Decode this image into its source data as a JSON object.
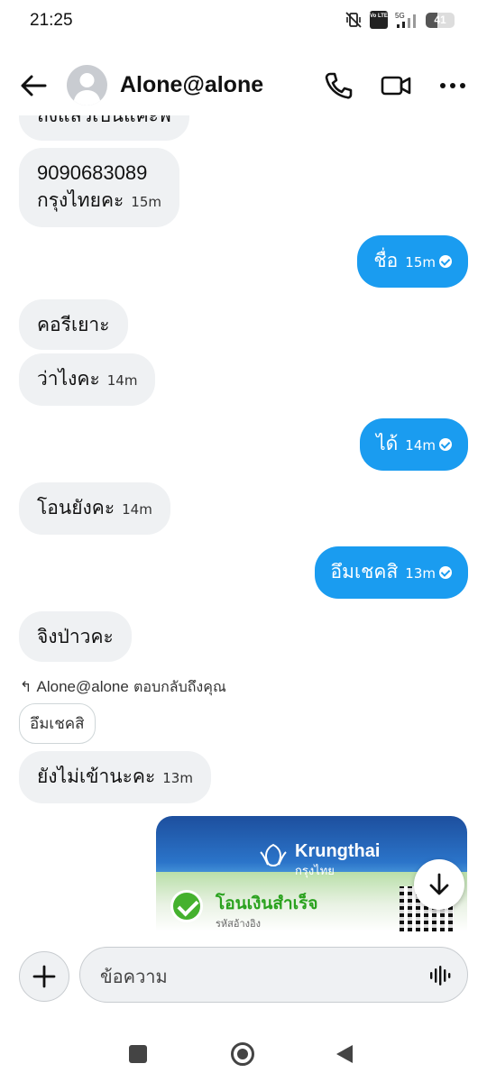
{
  "status_bar": {
    "time": "21:25",
    "volte": "Vo LTE",
    "network": "5G",
    "battery": "41",
    "battery_level": 0.41
  },
  "header": {
    "contact_name": "Alone@alone",
    "icons": [
      "back-arrow-icon",
      "avatar",
      "phone-icon",
      "video-camera-icon",
      "more-icon"
    ]
  },
  "messages": {
    "m0_text": "ถึงแล้วเป็นแคะพ",
    "m1_line1": "9090683089",
    "m1_line2": "กรุงไทยคะ",
    "m1_time": "15m",
    "m2_text": "ชื่อ",
    "m2_time": "15m",
    "m3_text": "คอรีเยาะ",
    "m4_text": "ว่าไงคะ",
    "m4_time": "14m",
    "m5_text": "ได้",
    "m5_time": "14m",
    "m6_text": "โอนยังคะ",
    "m6_time": "14m",
    "m7_text": "อึมเชคสิ",
    "m7_time": "13m",
    "m8_text": "จิงป่าวคะ",
    "reply_name": "Alone@alone",
    "reply_action": "ตอบกลับถึงคุณ",
    "quoted_text": "อึมเชคสิ",
    "m9_text": "ยังไม่เข้านะคะ",
    "m9_time": "13m"
  },
  "transfer_card": {
    "brand_en": "Krungthai",
    "brand_th": "กรุงไทย",
    "title": "โอนเงินสำเร็จ",
    "subtitle": "รหัสอ้างอิง"
  },
  "composer": {
    "placeholder": "ข้อความ"
  },
  "colors": {
    "accent": "#1a9cf0",
    "incoming_bubble": "#eff1f3",
    "success_green": "#45b12e"
  }
}
